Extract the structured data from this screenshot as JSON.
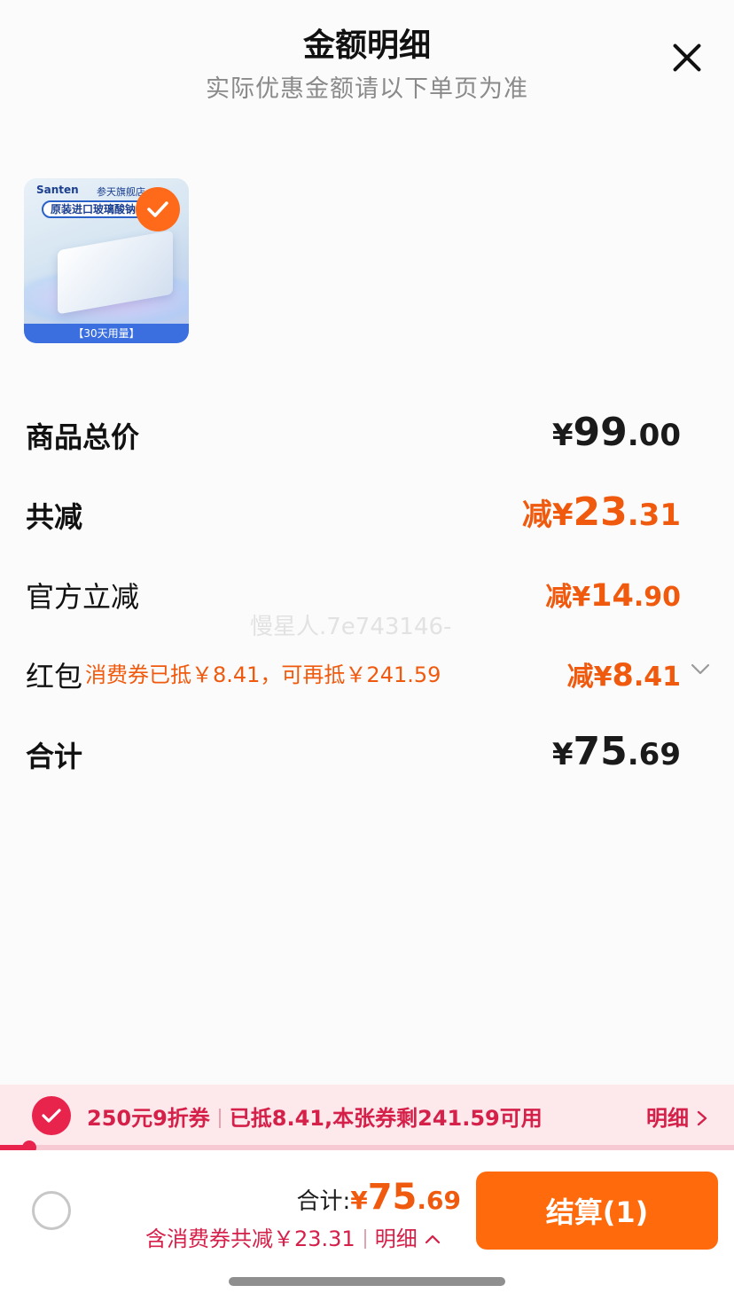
{
  "header": {
    "title": "金额明细",
    "subtitle": "实际优惠金额请以下单页为准"
  },
  "product": {
    "brand": "Santen",
    "store": "参天旗舰店",
    "banner": "原装进口玻璃酸钠滴",
    "footer": "【30天用量】",
    "selected": true
  },
  "rows": {
    "subtotal": {
      "label": "商品总价",
      "symbol": "¥",
      "int": "99",
      "dec": ".00"
    },
    "total_discount": {
      "label": "共减",
      "prefix": "减¥",
      "int": "23",
      "dec": ".31"
    },
    "official": {
      "label": "官方立减",
      "prefix": "减¥",
      "int": "14",
      "dec": ".90"
    },
    "red_packet": {
      "label": "红包",
      "note": "消费券已抵￥8.41，可再抵￥241.59",
      "prefix": "减¥",
      "int": "8",
      "dec": ".41"
    },
    "total": {
      "label": "合计",
      "symbol": "¥",
      "int": "75",
      "dec": ".69"
    }
  },
  "watermark": "慢星人.7e743146-",
  "coupon_bar": {
    "name": "250元9折券",
    "status": "已抵8.41,本张券剩241.59可用",
    "detail_label": "明细",
    "used_fraction": 0.04
  },
  "bottom_bar": {
    "total_label": "合计:",
    "total_symbol": "¥",
    "total_int": "75",
    "total_dec": ".69",
    "savings_text": "含消费券共减￥23.31",
    "detail_label": "明细",
    "checkout_label": "结算(1)"
  },
  "colors": {
    "accent_orange": "#f05a0e",
    "button_orange": "#ff6a0d",
    "coupon_red": "#e8244d",
    "coupon_bg": "#fde8ec"
  },
  "icons": {
    "close": "close-icon",
    "check": "check-icon",
    "chevron_down": "chevron-down-icon",
    "chevron_right": "chevron-right-icon",
    "chevron_up": "chevron-up-icon"
  }
}
